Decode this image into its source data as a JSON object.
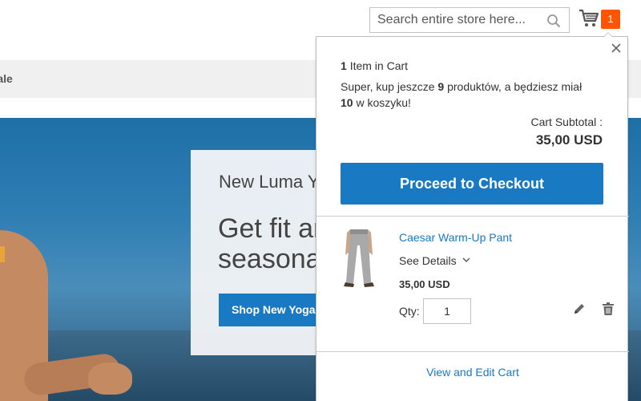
{
  "header": {
    "search_placeholder": "Search entire store here...",
    "cart_count": "1"
  },
  "nav": {
    "visible_item": "Sale"
  },
  "hero": {
    "title": "New Luma Yoga Collection",
    "headline_line1": "Get fit and look fab in new",
    "headline_line2": "seasonal styles",
    "button_label": "Shop New Yoga"
  },
  "minicart": {
    "items_count": "1",
    "items_label": "Item in Cart",
    "promo_prefix": "Super, kup jeszcze ",
    "promo_number": "9",
    "promo_middle": " produktów, a będziesz miał ",
    "promo_total": "10",
    "promo_suffix": " w koszyku!",
    "subtotal_label": "Cart Subtotal :",
    "subtotal_price": "35,00 USD",
    "checkout_label": "Proceed to Checkout",
    "view_edit_label": "View and Edit Cart",
    "item": {
      "name": "Caesar Warm-Up Pant",
      "details_label": "See Details",
      "price": "35,00 USD",
      "qty_label": "Qty:",
      "qty_value": "1"
    }
  },
  "colors": {
    "accent_blue": "#1979c3",
    "cart_badge": "#ff5501"
  }
}
